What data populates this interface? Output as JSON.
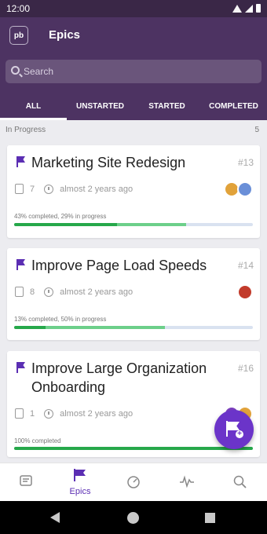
{
  "statusbar": {
    "time": "12:00"
  },
  "appbar": {
    "logo": "pb",
    "title": "Epics"
  },
  "search": {
    "placeholder": "Search"
  },
  "tabs": [
    {
      "label": "ALL",
      "active": true
    },
    {
      "label": "UNSTARTED",
      "active": false
    },
    {
      "label": "STARTED",
      "active": false
    },
    {
      "label": "COMPLETED",
      "active": false
    }
  ],
  "section": {
    "label": "In Progress",
    "count": "5"
  },
  "epics": [
    {
      "title": "Marketing Site Redesign",
      "number": "#13",
      "stories": "7",
      "updated": "almost 2 years ago",
      "progress_text": "43% completed, 29% in progress",
      "completed": 43,
      "in_progress": 29,
      "avatars": [
        "#e1a23a",
        "#e8a04a"
      ]
    },
    {
      "title": "Improve Page Load Speeds",
      "number": "#14",
      "stories": "8",
      "updated": "almost 2 years ago",
      "progress_text": "13% completed, 50% in progress",
      "completed": 13,
      "in_progress": 50,
      "avatars": [
        "#c23b2b"
      ]
    },
    {
      "title": "Improve Large Organization Onboarding",
      "number": "#16",
      "stories": "1",
      "updated": "almost 2 years ago",
      "progress_text": "100% completed",
      "completed": 100,
      "in_progress": 0,
      "avatars": [
        "#7b3fbf",
        "#e1a23a"
      ]
    }
  ],
  "bottomnav": [
    {
      "label": "",
      "icon": "stories-icon",
      "active": false
    },
    {
      "label": "Epics",
      "icon": "epics-icon",
      "active": true
    },
    {
      "label": "",
      "icon": "dashboard-icon",
      "active": false
    },
    {
      "label": "",
      "icon": "activity-icon",
      "active": false
    },
    {
      "label": "",
      "icon": "search-icon",
      "active": false
    }
  ],
  "colors": {
    "header": "#4d3362",
    "accent": "#6b34c9",
    "complete": "#26a84a",
    "in_progress": "#6ccf8a",
    "remaining": "#d9e2f0"
  }
}
